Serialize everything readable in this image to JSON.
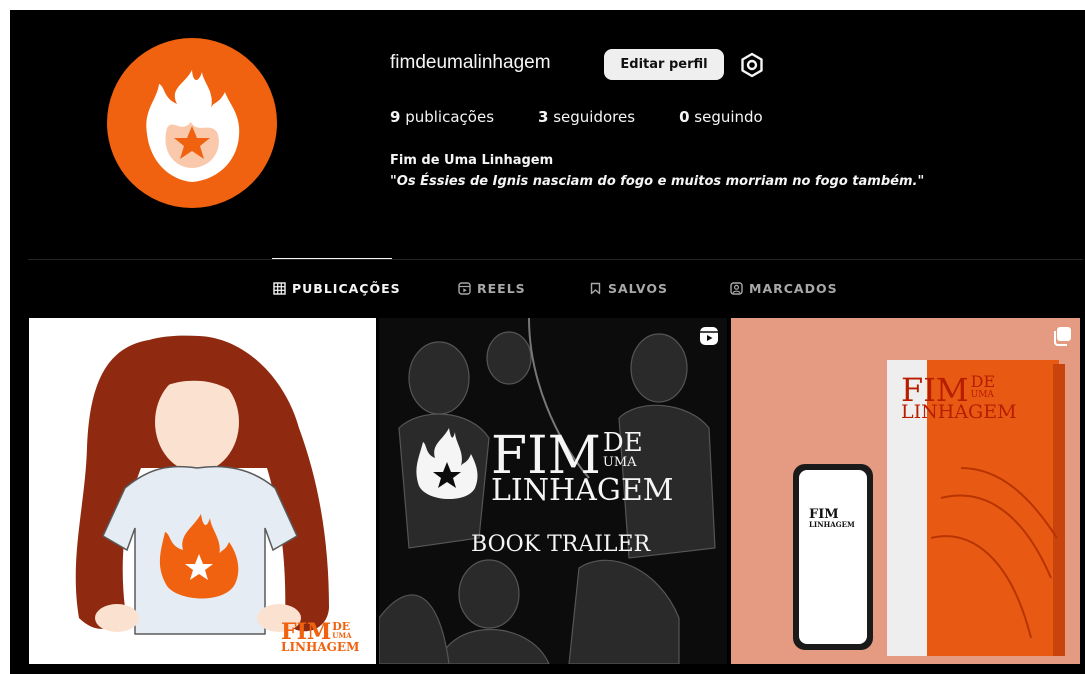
{
  "profile": {
    "username": "fimdeumalinhagem",
    "edit_profile_label": "Editar perfil",
    "stats": {
      "posts_count": "9",
      "posts_label": "publicações",
      "followers_count": "3",
      "followers_label": "seguidores",
      "following_count": "0",
      "following_label": "seguindo"
    },
    "full_name": "Fim de Uma Linhagem",
    "bio": "\"Os Éssies de Ignis nasciam do fogo e muitos morriam no fogo também.\""
  },
  "tabs": [
    {
      "label": "PUBLICAÇÕES",
      "icon": "grid-icon",
      "active": true
    },
    {
      "label": "REELS",
      "icon": "reels-icon",
      "active": false
    },
    {
      "label": "SALVOS",
      "icon": "bookmark-icon",
      "active": false
    },
    {
      "label": "MARCADOS",
      "icon": "tagged-icon",
      "active": false
    }
  ],
  "posts": [
    {
      "logo_main": "FIM",
      "logo_de": "DE",
      "logo_uma": "UMA",
      "logo_linhagem": "LINHAGEM"
    },
    {
      "logo_main": "FIM",
      "logo_de": "DE",
      "logo_uma": "UMA",
      "logo_linhagem": "LINHAGEM",
      "subtitle": "BOOK TRAILER",
      "badge_icon": "reel-icon"
    },
    {
      "logo_main": "FIM",
      "logo_de": "DE",
      "logo_uma": "UMA",
      "logo_linhagem": "LINHAGEM",
      "badge_icon": "carousel-icon"
    }
  ],
  "colors": {
    "background": "#000000",
    "brand_orange": "#f0620f",
    "tab_inactive": "#a8a8a8",
    "button_bg": "#efefef"
  }
}
